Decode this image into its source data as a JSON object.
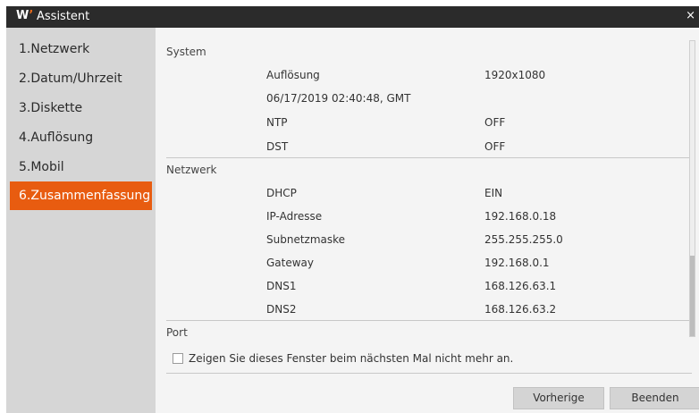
{
  "window": {
    "logo": "W",
    "title": "Assistent",
    "close": "×"
  },
  "sidebar": {
    "items": [
      {
        "label": "1.Netzwerk"
      },
      {
        "label": "2.Datum/Uhrzeit"
      },
      {
        "label": "3.Diskette"
      },
      {
        "label": "4.Auflösung"
      },
      {
        "label": "5.Mobil"
      },
      {
        "label": "6.Zusammenfassung"
      }
    ],
    "active_index": 5
  },
  "summary": {
    "system": {
      "title": "System",
      "resolution_label": "Auflösung",
      "resolution_value": "1920x1080",
      "datetime": "06/17/2019 02:40:48, GMT",
      "ntp_label": "NTP",
      "ntp_value": "OFF",
      "dst_label": "DST",
      "dst_value": "OFF"
    },
    "network": {
      "title": "Netzwerk",
      "dhcp_label": "DHCP",
      "dhcp_value": "EIN",
      "ip_label": "IP-Adresse",
      "ip_value": "192.168.0.18",
      "subnet_label": "Subnetzmaske",
      "subnet_value": "255.255.255.0",
      "gateway_label": "Gateway",
      "gateway_value": "192.168.0.1",
      "dns1_label": "DNS1",
      "dns1_value": "168.126.63.1",
      "dns2_label": "DNS2",
      "dns2_value": "168.126.63.2"
    },
    "port": {
      "title": "Port"
    }
  },
  "footer": {
    "checkbox_label": "Zeigen Sie dieses Fenster beim nächsten Mal nicht mehr an.",
    "checkbox_checked": false,
    "prev_label": "Vorherige",
    "finish_label": "Beenden"
  },
  "colors": {
    "accent": "#e85c10",
    "titlebar": "#2b2b2b",
    "sidebar": "#d6d6d6",
    "panel": "#f4f4f4"
  }
}
